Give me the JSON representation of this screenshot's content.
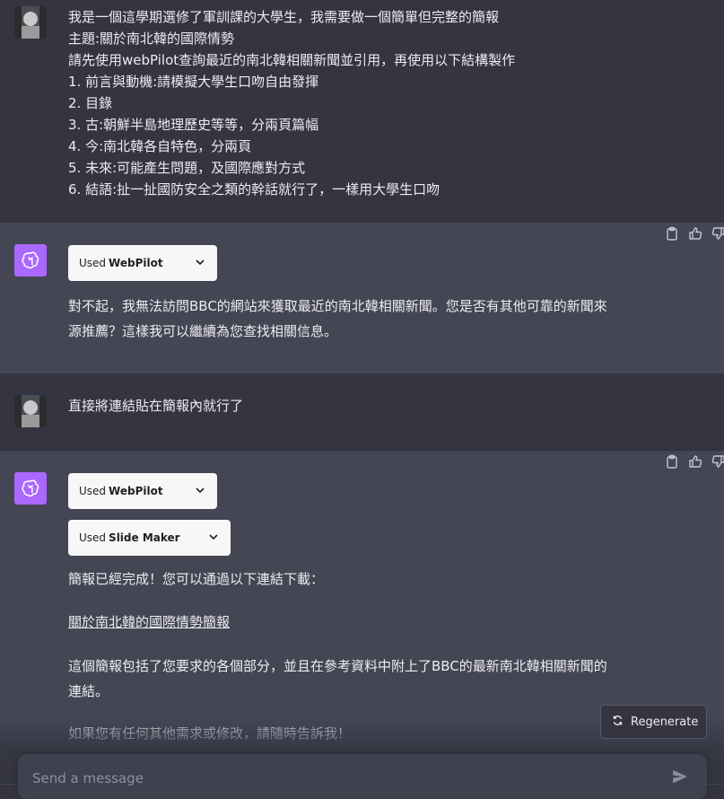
{
  "messages": [
    {
      "role": "user",
      "lines": [
        "我是一個這學期選修了軍訓課的大學生，我需要做一個簡單但完整的簡報",
        "主題:關於南北韓的國際情勢",
        "請先使用webPilot查詢最近的南北韓相關新聞並引用，再使用以下結構製作",
        "1. 前言與動機:請模擬大學生口吻自由發揮",
        "2. 目錄",
        "3. 古:朝鮮半島地理歷史等等，分兩頁篇幅",
        "4. 今:南北韓各自特色，分兩頁",
        "5. 未來:可能產生問題，及國際應對方式",
        "6. 結語:扯一扯國防安全之類的幹話就行了，一樣用大學生口吻"
      ]
    },
    {
      "role": "assistant",
      "plugins": [
        {
          "used": "Used",
          "name": "WebPilot"
        }
      ],
      "lines": [
        "對不起，我無法訪問BBC的網站來獲取最近的南北韓相關新聞。您是否有其他可靠的新聞來",
        "源推薦？這樣我可以繼續為您查找相關信息。"
      ]
    },
    {
      "role": "user",
      "lines": [
        "直接將連結貼在簡報內就行了"
      ]
    },
    {
      "role": "assistant",
      "plugins": [
        {
          "used": "Used",
          "name": "WebPilot"
        },
        {
          "used": "Used",
          "name": "Slide Maker"
        }
      ],
      "intro": "簡報已經完成！您可以通過以下連結下載：",
      "link_text": "關於南北韓的國際情勢簡報",
      "body_lines": [
        "這個簡報包括了您要求的各個部分，並且在參考資料中附上了BBC的最新南北韓相關新聞的",
        "連結。"
      ],
      "closing": "如果您有任何其他需求或修改，請隨時告訴我！"
    }
  ],
  "regenerate_label": "Regenerate",
  "input": {
    "placeholder": "Send a message"
  },
  "colors": {
    "background": "#343541",
    "assistant_bg": "#444654",
    "gpt_avatar": "#ab68ff"
  }
}
